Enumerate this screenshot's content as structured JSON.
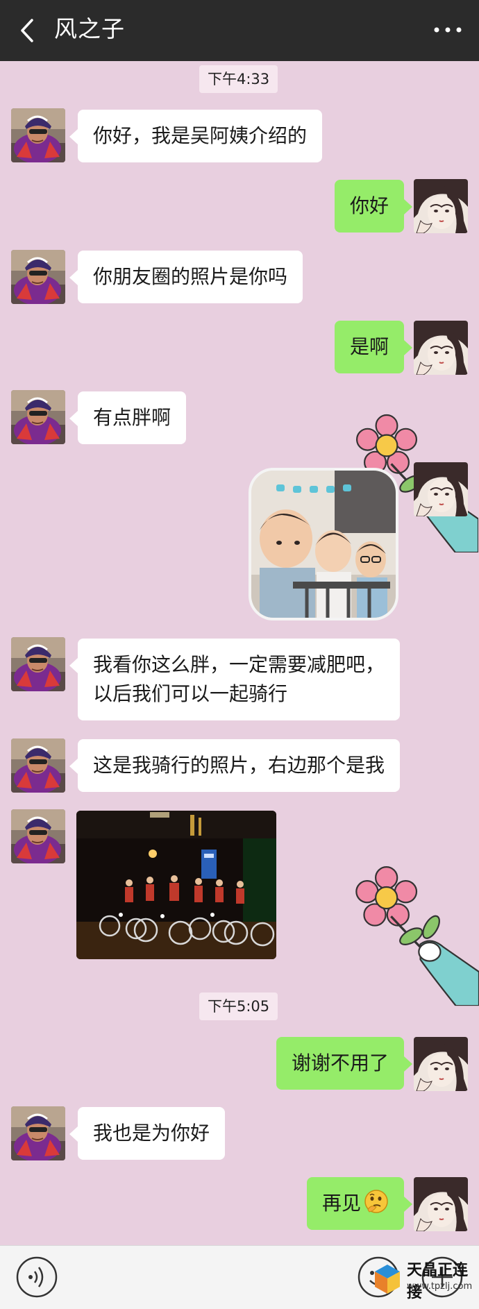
{
  "header": {
    "title": "风之子",
    "back_icon": "chevron-left-icon",
    "more_icon": "more-dots-icon"
  },
  "messages": [
    {
      "type": "time",
      "text": "下午4:33"
    },
    {
      "type": "text",
      "side": "left",
      "text": "你好，我是吴阿姨介绍的"
    },
    {
      "type": "text",
      "side": "right",
      "text": "你好"
    },
    {
      "type": "text",
      "side": "left",
      "text": "你朋友圈的照片是你吗"
    },
    {
      "type": "text",
      "side": "right",
      "text": "是啊"
    },
    {
      "type": "text",
      "side": "left",
      "text": "有点胖啊"
    },
    {
      "type": "sticker",
      "side": "right",
      "icon": "kids-sticker-image"
    },
    {
      "type": "text",
      "side": "left",
      "lines": [
        "我看你这么胖，一定需要减肥吧，",
        "以后我们可以一起骑行"
      ]
    },
    {
      "type": "text",
      "side": "left",
      "text": "这是我骑行的照片，右边那个是我"
    },
    {
      "type": "image",
      "side": "left",
      "icon": "night-cycling-photo"
    },
    {
      "type": "time",
      "text": "下午5:05"
    },
    {
      "type": "text",
      "side": "right",
      "text": "谢谢不用了"
    },
    {
      "type": "text",
      "side": "left",
      "text": "我也是为你好"
    },
    {
      "type": "text",
      "side": "right",
      "text": "再见",
      "emoji": "thinking-face-icon"
    }
  ],
  "input_bar": {
    "voice_icon": "voice-icon",
    "emoji_icon": "emoji-icon",
    "plus_icon": "plus-icon"
  },
  "watermark": {
    "cn": "天晶正连接",
    "url": "www.tpzlj.com"
  },
  "colors": {
    "header_bg": "#2b2b2b",
    "chat_bg": "#e8cfdf",
    "bubble_left": "#ffffff",
    "bubble_right": "#95ec69"
  }
}
